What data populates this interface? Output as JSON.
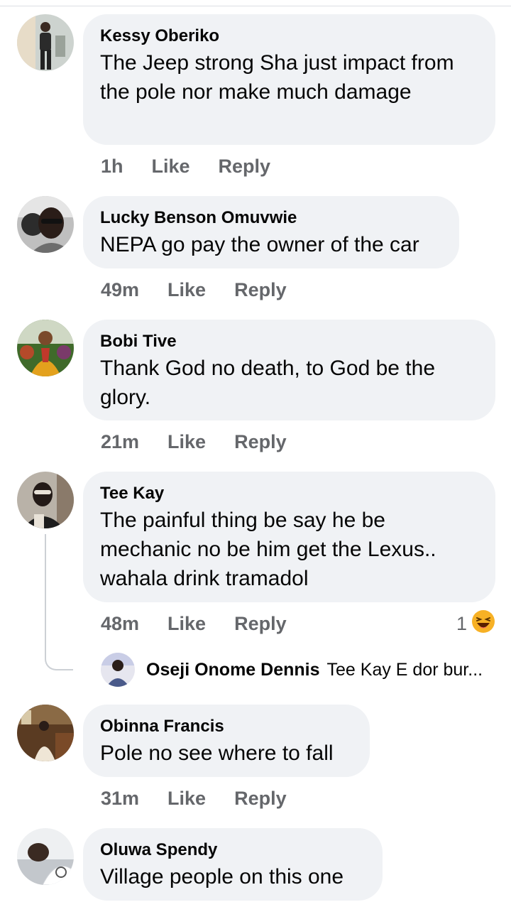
{
  "comments": [
    {
      "author": "Kessy Oberiko",
      "text": "The Jeep strong Sha just impact from the pole nor make much damage",
      "time": "1h",
      "like": "Like",
      "reply": "Reply",
      "avatar_colors": [
        "#cdd3cf",
        "#2b2b2b",
        "#9aa29a"
      ]
    },
    {
      "author": "Lucky Benson Omuvwie",
      "text": "NEPA go pay the owner of the car",
      "time": "49m",
      "like": "Like",
      "reply": "Reply",
      "avatar_colors": [
        "#6d6d6d",
        "#2a1d18",
        "#bfbfbf"
      ]
    },
    {
      "author": "Bobi Tive",
      "text": "Thank God no death, to God be the glory.",
      "time": "21m",
      "like": "Like",
      "reply": "Reply",
      "avatar_colors": [
        "#7a4a2b",
        "#e3a11d",
        "#3f6a2a"
      ]
    },
    {
      "author": "Tee Kay",
      "text": "The painful thing be say he be mechanic no be him get the Lexus.. wahala drink tramadol",
      "time": "48m",
      "like": "Like",
      "reply": "Reply",
      "avatar_colors": [
        "#b9b2a8",
        "#231a17",
        "#e8e2d8"
      ],
      "reaction_count": "1",
      "reaction_icon": "laughing-emoji-icon",
      "reply_preview": {
        "author": "Oseji Onome Dennis",
        "text": "Tee Kay E dor bur...",
        "avatar_colors": [
          "#4a5a8a",
          "#e6e6ef"
        ]
      }
    },
    {
      "author": "Obinna Francis",
      "text": "Pole no see where to fall",
      "time": "31m",
      "like": "Like",
      "reply": "Reply",
      "avatar_colors": [
        "#5a3b22",
        "#efe6d6",
        "#8a6a45"
      ]
    },
    {
      "author": "Oluwa Spendy",
      "text": "Village people on this one",
      "avatar_colors": [
        "#c3c7cc",
        "#3a2a22",
        "#eef0f2"
      ]
    }
  ]
}
